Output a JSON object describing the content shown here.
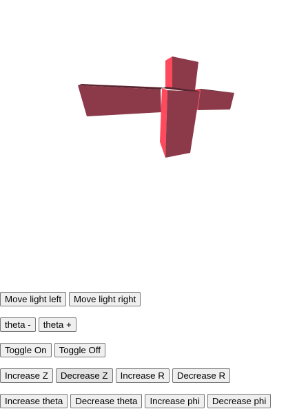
{
  "scene": {
    "colors": {
      "front_face": "#8c3a4a",
      "top_face": "#5a2530",
      "side_face": "#ff4a5e"
    }
  },
  "controls": {
    "row1": {
      "move_light_left": "Move light left",
      "move_light_right": "Move light right"
    },
    "row2": {
      "theta_minus": "theta -",
      "theta_plus": "theta +"
    },
    "row3": {
      "toggle_on": "Toggle On",
      "toggle_off": "Toggle Off"
    },
    "row4": {
      "increase_z": "Increase Z",
      "decrease_z": "Decrease Z",
      "increase_r": "Increase R",
      "decrease_r": "Decrease R"
    },
    "row5": {
      "increase_theta": "Increase theta",
      "decrease_theta": "Decrease theta",
      "increase_phi": "Increase phi",
      "decrease_phi": "Decrease phi"
    }
  }
}
